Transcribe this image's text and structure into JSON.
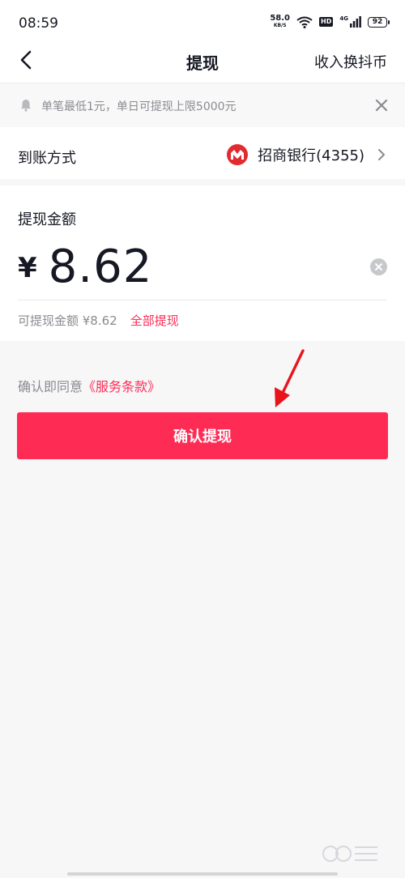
{
  "status_bar": {
    "time": "08:59",
    "net_speed_value": "58.0",
    "net_speed_unit": "KB/S",
    "hd_label": "HD",
    "signal_label": "4G",
    "battery_level": "92"
  },
  "nav": {
    "title": "提现",
    "action_label": "收入换抖币",
    "back_icon": "chevron-left-icon"
  },
  "notice": {
    "text": "单笔最低1元，单日可提现上限5000元",
    "icon": "bell-icon",
    "close_icon": "close-icon"
  },
  "payout_method": {
    "label": "到账方式",
    "bank_name": "招商银行(4355)",
    "bank_logo": "china-merchants-bank-logo",
    "chevron_icon": "chevron-right-icon"
  },
  "amount": {
    "label": "提现金额",
    "currency_symbol": "¥",
    "value": "8.62",
    "clear_icon": "clear-icon",
    "available_text": "可提现金额 ¥8.62",
    "withdraw_all_label": "全部提现"
  },
  "terms": {
    "prefix": "确认即同意",
    "link_text": "《服务条款》"
  },
  "confirm_button_label": "确认提现",
  "colors": {
    "accent": "#fe2c55",
    "text_primary": "#161823",
    "text_secondary": "#8a8b91",
    "background": "#f7f7f8"
  }
}
